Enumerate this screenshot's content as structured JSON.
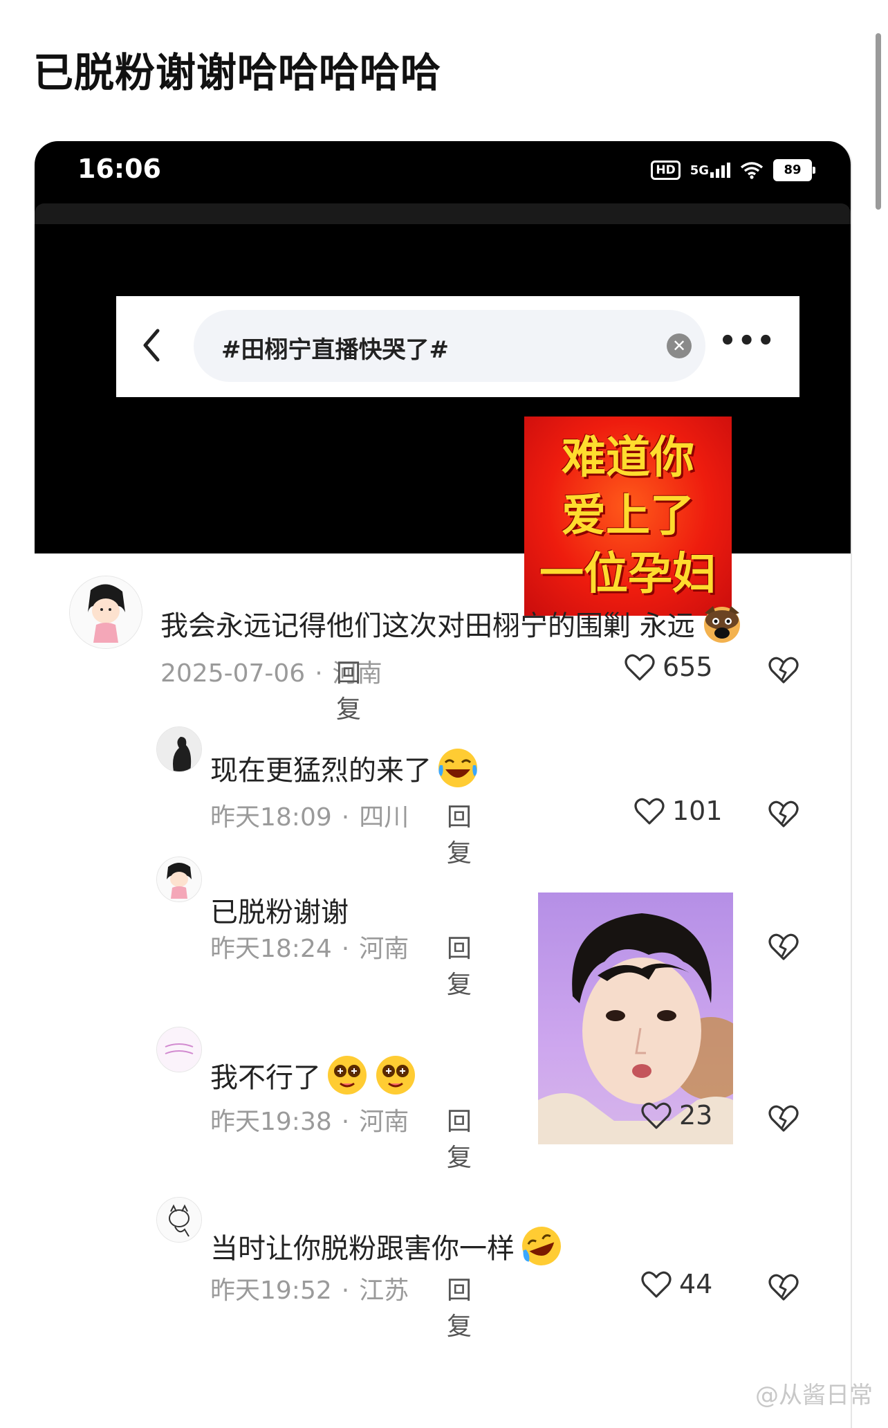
{
  "post": {
    "title": "已脱粉谢谢哈哈哈哈哈"
  },
  "statusbar": {
    "time": "16:06",
    "hd": "HD",
    "network": "5G",
    "battery": "89"
  },
  "search": {
    "query": "#田栩宁直播快哭了#"
  },
  "sticker": {
    "lines": [
      "难道你",
      "爱上了",
      "一位孕妇"
    ]
  },
  "comments": [
    {
      "text": "我会永远记得他们这次对田栩宁的围剿 永远",
      "date": "2025-07-06",
      "location": "河南",
      "reply": "回复",
      "likes": "655"
    },
    {
      "text": "现在更猛烈的来了",
      "date": "昨天18:09",
      "location": "四川",
      "reply": "回复",
      "likes": "101"
    },
    {
      "text": "已脱粉谢谢",
      "date": "昨天18:24",
      "location": "河南",
      "reply": "回复",
      "likes": ""
    },
    {
      "text": "我不行了",
      "date": "昨天19:38",
      "location": "河南",
      "reply": "回复",
      "likes": "23"
    },
    {
      "text": "当时让你脱粉跟害你一样",
      "date": "昨天19:52",
      "location": "江苏",
      "reply": "回复",
      "likes": "44"
    }
  ],
  "meta_separator": "·",
  "watermark": "@从酱日常"
}
